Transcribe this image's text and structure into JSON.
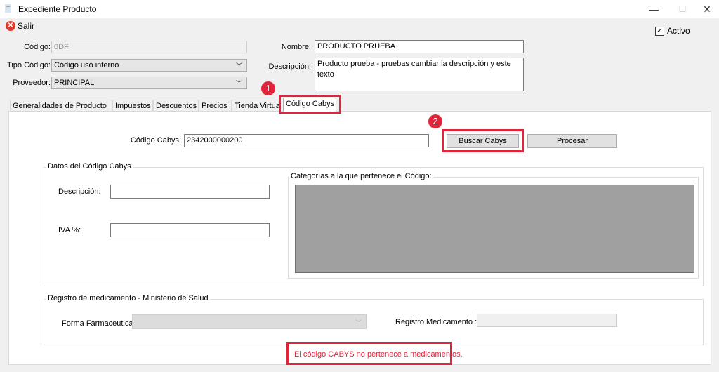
{
  "window": {
    "title": "Expediente Producto"
  },
  "toolbar": {
    "salir_label": "Salir"
  },
  "activo": {
    "label": "Activo",
    "checked": true
  },
  "form": {
    "codigo_label": "Código:",
    "codigo_value": "0DF",
    "tipo_codigo_label": "Tipo Código:",
    "tipo_codigo_value": "Código uso interno",
    "proveedor_label": "Proveedor:",
    "proveedor_value": "PRINCIPAL",
    "nombre_label": "Nombre:",
    "nombre_value": "PRODUCTO PRUEBA",
    "descripcion_label": "Descripción:",
    "descripcion_value": "Producto prueba - pruebas cambiar la descripción y este texto"
  },
  "tabs": [
    {
      "label": "Generalidades de Producto"
    },
    {
      "label": "Impuestos"
    },
    {
      "label": "Descuentos"
    },
    {
      "label": "Precios"
    },
    {
      "label": "Tienda Virtual"
    },
    {
      "label": "Código Cabys",
      "active": true
    }
  ],
  "badges": {
    "one": "1",
    "two": "2"
  },
  "cabys": {
    "codigo_label": "Código Cabys:",
    "codigo_value": "2342000000200",
    "buscar_label": "Buscar Cabys",
    "procesar_label": "Procesar",
    "datos_group": "Datos del Código Cabys",
    "descripcion_label": "Descripción:",
    "descripcion_value": "",
    "iva_label": "IVA %:",
    "iva_value": "",
    "categorias_label": "Categorías a la que pertenece el Código:"
  },
  "medicamento": {
    "group_label": "Registro de medicamento - Ministerio de Salud",
    "forma_label": "Forma Farmaceutica:",
    "forma_value": "",
    "registro_label": "Registro Medicamento :",
    "registro_value": ""
  },
  "message": "El código CABYS no pertenece a medicamentos."
}
